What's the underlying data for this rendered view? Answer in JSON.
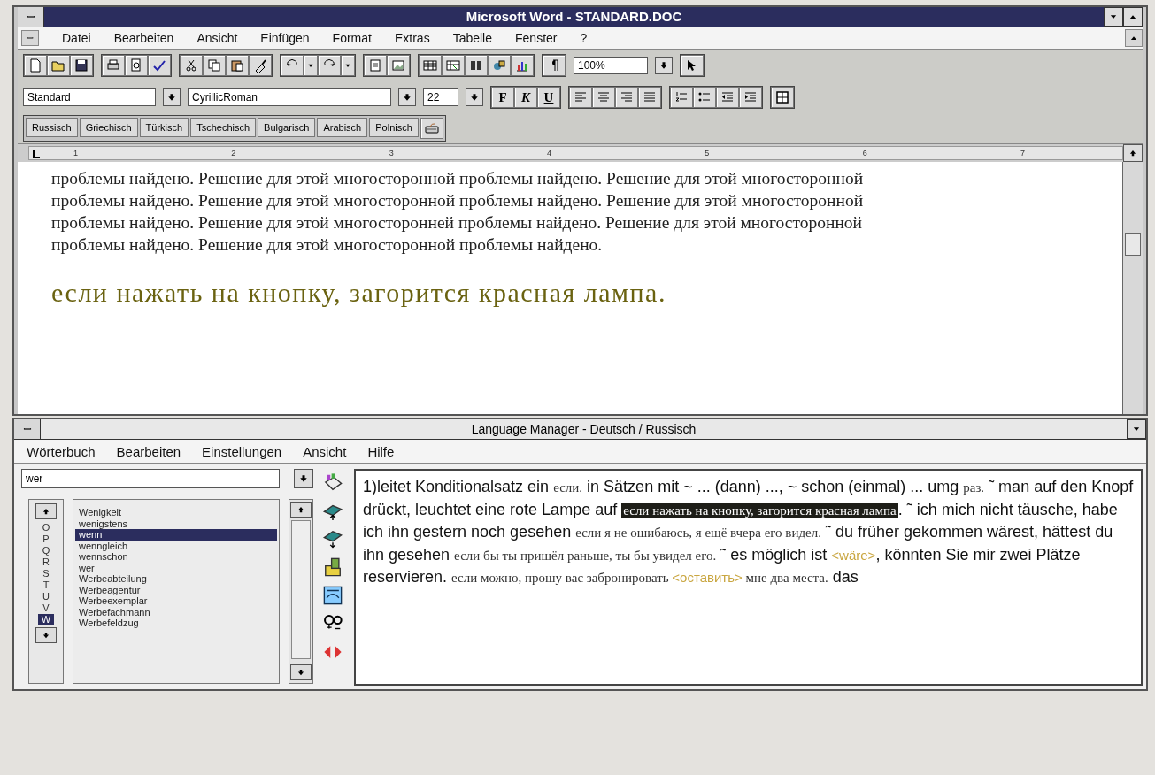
{
  "word": {
    "title": "Microsoft Word - STANDARD.DOC",
    "menu": [
      "Datei",
      "Bearbeiten",
      "Ansicht",
      "Einfügen",
      "Format",
      "Extras",
      "Tabelle",
      "Fenster",
      "?"
    ],
    "zoom": "100%",
    "style": "Standard",
    "font": "CyrillicRoman",
    "size": "22",
    "format_buttons": [
      "F",
      "K",
      "U"
    ],
    "language_buttons": [
      "Russisch",
      "Griechisch",
      "Türkisch",
      "Tschechisch",
      "Bulgarisch",
      "Arabisch",
      "Polnisch"
    ],
    "ruler": [
      "1",
      "2",
      "3",
      "4",
      "5",
      "6",
      "7"
    ],
    "paragraph": "проблемы найдено. Решение для этой многосторонной проблемы найдено. Решение для этой многосторонной проблемы найдено. Решение для этой многосторонной проблемы найдено. Решение для этой многосторонной проблемы найдено. Решение для этой многосторонней проблемы найдено. Решение для этой многосторонной проблемы найдено. Решение для этой многосторонной проблемы найдено.",
    "large_line": "если нажать на кнопку, загорится красная лампа."
  },
  "language_manager": {
    "title": "Language Manager - Deutsch / Russisch",
    "menu": [
      "Wörterbuch",
      "Bearbeiten",
      "Einstellungen",
      "Ansicht",
      "Hilfe"
    ],
    "search": {
      "value": "wer"
    },
    "letters": [
      {
        "label": "O",
        "selected": false
      },
      {
        "label": "P",
        "selected": false
      },
      {
        "label": "Q",
        "selected": false
      },
      {
        "label": "R",
        "selected": false
      },
      {
        "label": "S",
        "selected": false
      },
      {
        "label": "T",
        "selected": false
      },
      {
        "label": "U",
        "selected": false
      },
      {
        "label": "V",
        "selected": false
      },
      {
        "label": "W",
        "selected": true
      }
    ],
    "words": [
      {
        "label": "Wenigkeit",
        "selected": false
      },
      {
        "label": "wenigstens",
        "selected": false
      },
      {
        "label": "wenn",
        "selected": true
      },
      {
        "label": "wenngleich",
        "selected": false
      },
      {
        "label": "wennschon",
        "selected": false
      },
      {
        "label": "wer",
        "selected": false
      },
      {
        "label": "Werbeabteilung",
        "selected": false
      },
      {
        "label": "Werbeagentur",
        "selected": false
      },
      {
        "label": "Werbeexemplar",
        "selected": false
      },
      {
        "label": "Werbefachmann",
        "selected": false
      },
      {
        "label": "Werbefeldzug",
        "selected": false
      }
    ],
    "definition": [
      {
        "kind": "de",
        "text": "1)leitet Konditionalsatz ein "
      },
      {
        "kind": "ru",
        "text": "если."
      },
      {
        "kind": "de",
        "text": " in Sätzen mit ~ ... (dann) ...,  ~ schon (einmal) ... umg "
      },
      {
        "kind": "ru",
        "text": "раз."
      },
      {
        "kind": "de",
        "text": " ˜ man auf den Knopf drückt, leuchtet  eine rote Lampe auf "
      },
      {
        "kind": "highlight",
        "text": "если нажать на кнопку, загорится красная лампа"
      },
      {
        "kind": "de",
        "text": ". ˜  ich mich nicht täusche, habe ich ihn gestern noch gesehen "
      },
      {
        "kind": "ru",
        "text": "если я не ошибаюсь, я ещё вчера его видел."
      },
      {
        "kind": "de",
        "text": " ˜ du früher gekommen wärest, hättest  du ihn gesehen "
      },
      {
        "kind": "ru",
        "text": "если бы ты пришёл раньше, ты бы увидел его."
      },
      {
        "kind": "de",
        "text": " ˜ es möglich ist "
      },
      {
        "kind": "hint",
        "text": "<wäre>"
      },
      {
        "kind": "de",
        "text": ", könnten Sie mir zwei Plätze reservieren. "
      },
      {
        "kind": "ru",
        "text": "если можно, прошу вас забронировать "
      },
      {
        "kind": "hint",
        "text": "<оставить>"
      },
      {
        "kind": "ru",
        "text": " мне два места."
      },
      {
        "kind": "de",
        "text": " das"
      }
    ]
  }
}
